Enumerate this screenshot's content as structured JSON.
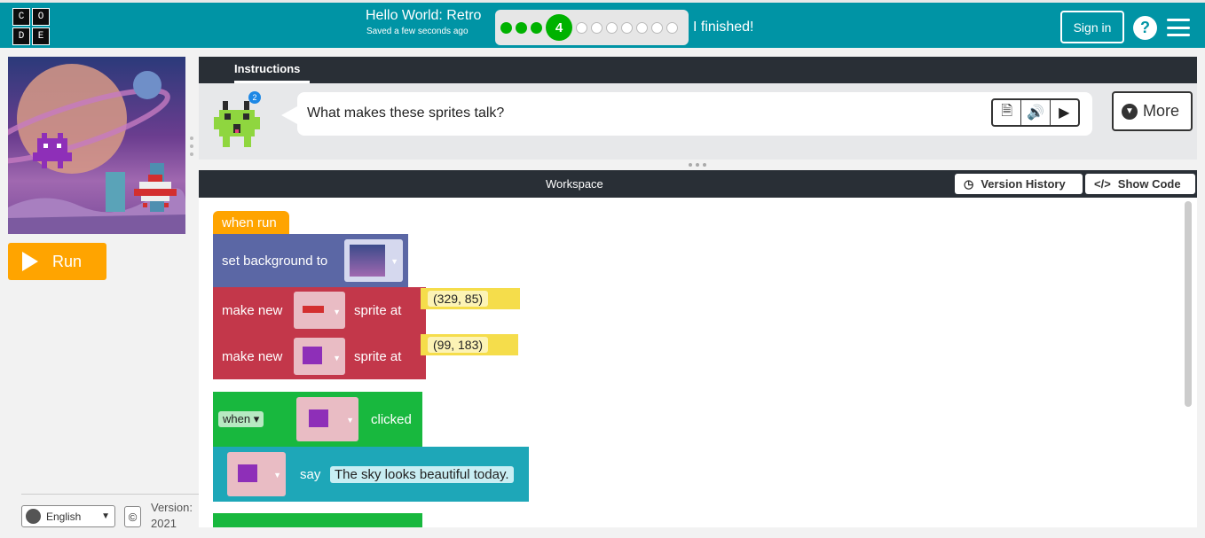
{
  "header": {
    "logo_letters": [
      "C",
      "O",
      "D",
      "E"
    ],
    "project_title": "Hello World: Retro",
    "saved_status": "Saved a few seconds ago",
    "progress": {
      "current_level": "4",
      "completed_before": 3,
      "remaining_after": 7
    },
    "finished_label": "I finished!",
    "sign_in_label": "Sign in",
    "help_label": "?"
  },
  "run_button": {
    "label": "Run"
  },
  "footer": {
    "language_value": "English",
    "copyright_symbol": "©",
    "version_label": "Version:",
    "version_value": "2021"
  },
  "instructions": {
    "tab_label": "Instructions",
    "text": "What makes these sprites talk?",
    "badge_count": "2",
    "more_label": "More"
  },
  "workspace": {
    "title": "Workspace",
    "version_history_label": "Version History",
    "show_code_label": "Show Code",
    "blocks": {
      "when_run": "when run",
      "set_background": "set background to",
      "make_new": "make new",
      "sprite_at": "sprite at",
      "coord1": "(329, 85)",
      "coord2": "(99, 183)",
      "when": "when",
      "clicked": "clicked",
      "say": "say",
      "say_text": "The sky looks beautiful today."
    }
  },
  "colors": {
    "header_bg": "#0094a5",
    "run_button": "#ffa400",
    "progress_done": "#00b200",
    "block_event": "#ffa400",
    "block_world": "#5b67a5",
    "block_sprite": "#c3374a",
    "block_green": "#18b83e",
    "block_teal": "#1ea7b8"
  }
}
